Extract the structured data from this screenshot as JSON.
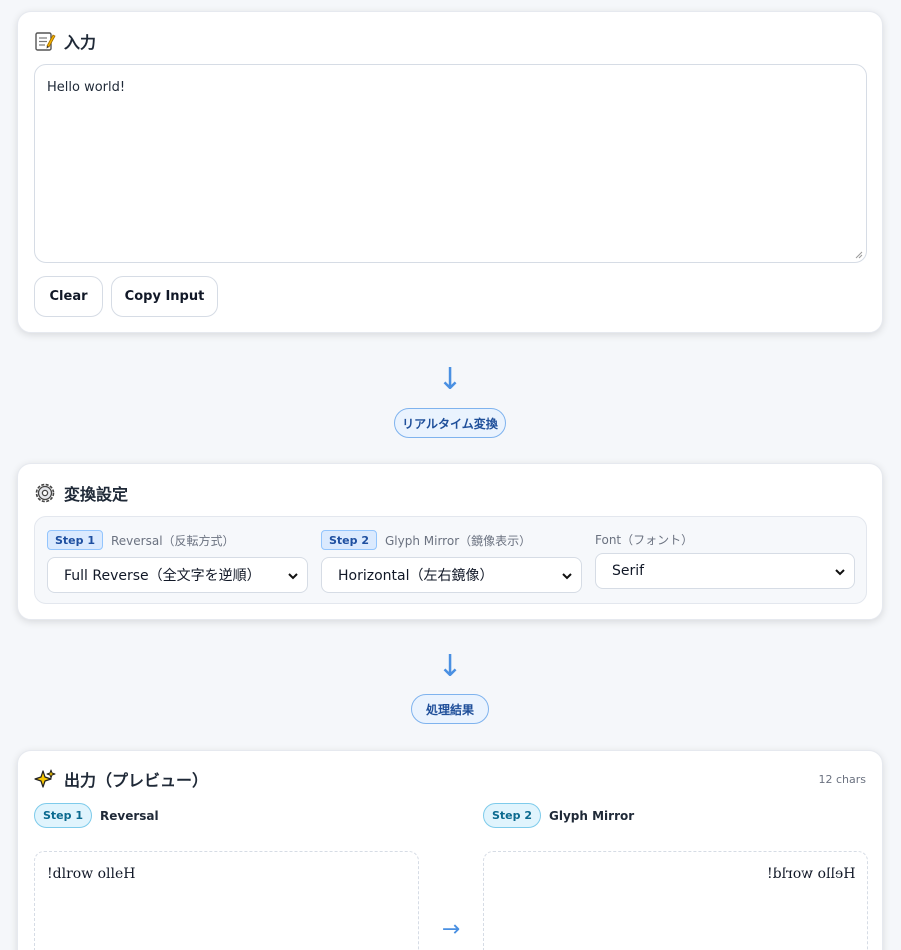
{
  "input": {
    "title": "入力",
    "icon": "memo-icon",
    "text": "Hello world!",
    "buttons": {
      "clear": "Clear",
      "copy": "Copy Input"
    }
  },
  "flow": {
    "realtime_label": "リアルタイム変換",
    "result_label": "処理結果",
    "arrow": "↓"
  },
  "settings": {
    "title": "変換設定",
    "icon": "gear-icon",
    "reversal": {
      "step": "Step 1",
      "label": "Reversal（反転方式）",
      "selected": "Full Reverse（全文字を逆順）"
    },
    "mirror": {
      "step": "Step 2",
      "label": "Glyph Mirror（鏡像表示）",
      "selected": "Horizontal（左右鏡像）"
    },
    "font": {
      "label": "Font（フォント）",
      "selected": "Serif"
    }
  },
  "output": {
    "title": "出力（プレビュー）",
    "icon": "sparkles-icon",
    "char_count": "12 chars",
    "step1": {
      "badge": "Step 1",
      "label": "Reversal",
      "text": "!dlrow olleH"
    },
    "step2": {
      "badge": "Step 2",
      "label": "Glyph Mirror",
      "text": "Hello world!"
    },
    "arrow": "→"
  },
  "colors": {
    "accent": "#4a90e2",
    "background": "#f5f7fa"
  }
}
